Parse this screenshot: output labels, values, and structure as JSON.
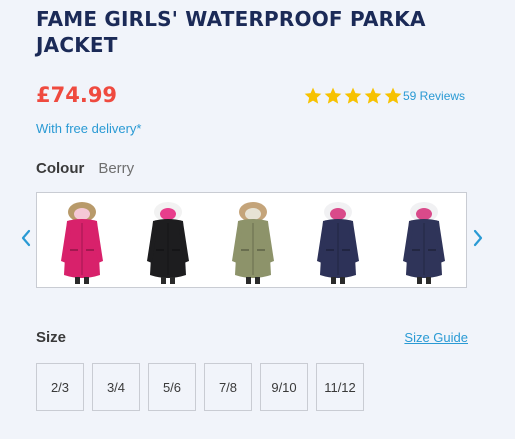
{
  "product": {
    "title": "FAME GIRLS' WATERPROOF PARKA JACKET",
    "price": "£74.99",
    "rating": 5,
    "reviews_label": "59 Reviews",
    "delivery_label": "With free delivery*"
  },
  "colour": {
    "label": "Colour",
    "selected": "Berry",
    "swatches": [
      {
        "name": "Berry",
        "body": "#d8216b",
        "trim": "#b89a6a",
        "lining": "#f5c8d6"
      },
      {
        "name": "Black",
        "body": "#1d1d1f",
        "trim": "#f2f2f2",
        "lining": "#e83d8c"
      },
      {
        "name": "Khaki",
        "body": "#8d936a",
        "trim": "#c4a47a",
        "lining": "#e7e3d5"
      },
      {
        "name": "Navy",
        "body": "#2d3258",
        "trim": "#f1f1f3",
        "lining": "#d94a8a"
      },
      {
        "name": "Navy",
        "body": "#2f3459",
        "trim": "#f1f1f3",
        "lining": "#d94a8a"
      }
    ]
  },
  "size": {
    "label": "Size",
    "guide_label": "Size Guide",
    "options": [
      "2/3",
      "3/4",
      "5/6",
      "7/8",
      "9/10",
      "11/12"
    ]
  },
  "colors": {
    "title": "#1b2a57",
    "price": "#ef4a3f",
    "link": "#2a9ad4",
    "star": "#f7c200",
    "background": "#f1f4fa"
  },
  "icons": {
    "prev": "chevron-left-icon",
    "next": "chevron-right-icon",
    "star": "star-icon"
  }
}
